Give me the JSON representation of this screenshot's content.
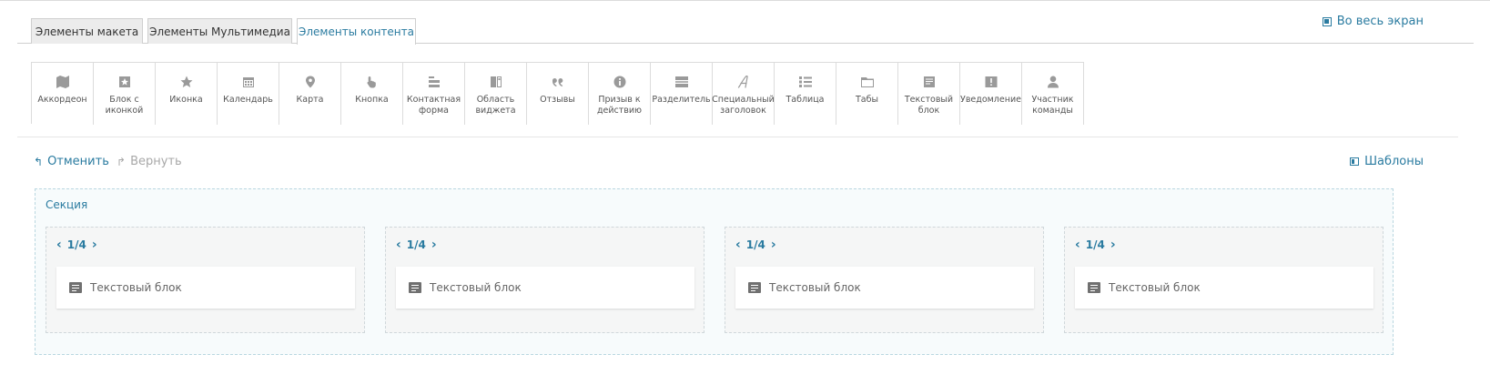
{
  "tabs": [
    {
      "label": "Элементы макета",
      "active": false
    },
    {
      "label": "Элементы Мультимедиа",
      "active": false
    },
    {
      "label": "Элементы контента",
      "active": true
    }
  ],
  "fullscreen_label": "Во весь экран",
  "elements": [
    {
      "label": "Аккордеон",
      "icon": "map-icon"
    },
    {
      "label": "Блок с\nиконкой",
      "icon": "star-box-icon"
    },
    {
      "label": "Иконка",
      "icon": "star-icon"
    },
    {
      "label": "Календарь",
      "icon": "calendar-icon"
    },
    {
      "label": "Карта",
      "icon": "map-pin-icon"
    },
    {
      "label": "Кнопка",
      "icon": "pointer-hand-icon"
    },
    {
      "label": "Контактная\nформа",
      "icon": "form-icon"
    },
    {
      "label": "Область\nвиджета",
      "icon": "widget-area-icon"
    },
    {
      "label": "Отзывы",
      "icon": "quote-icon"
    },
    {
      "label": "Призыв к\nдействию",
      "icon": "info-circle-icon"
    },
    {
      "label": "Разделитель",
      "icon": "divider-icon"
    },
    {
      "label": "Специальный\nзаголовок",
      "icon": "script-a-icon"
    },
    {
      "label": "Таблица",
      "icon": "list-table-icon"
    },
    {
      "label": "Табы",
      "icon": "folder-tab-icon"
    },
    {
      "label": "Текстовый\nблок",
      "icon": "text-block-icon"
    },
    {
      "label": "Уведомление",
      "icon": "alert-box-icon"
    },
    {
      "label": "Участник\nкоманды",
      "icon": "person-icon"
    }
  ],
  "toolbar": {
    "undo_label": "Отменить",
    "redo_label": "Вернуть",
    "templates_label": "Шаблоны"
  },
  "section": {
    "title": "Секция",
    "columns": [
      {
        "fraction": "1/4",
        "block_label": "Текстовый блок"
      },
      {
        "fraction": "1/4",
        "block_label": "Текстовый блок"
      },
      {
        "fraction": "1/4",
        "block_label": "Текстовый блок"
      },
      {
        "fraction": "1/4",
        "block_label": "Текстовый блок"
      }
    ]
  },
  "colors": {
    "accent": "#2a7ba0",
    "icon_gray": "#9a9a9a",
    "section_border": "#b9d7e0"
  }
}
